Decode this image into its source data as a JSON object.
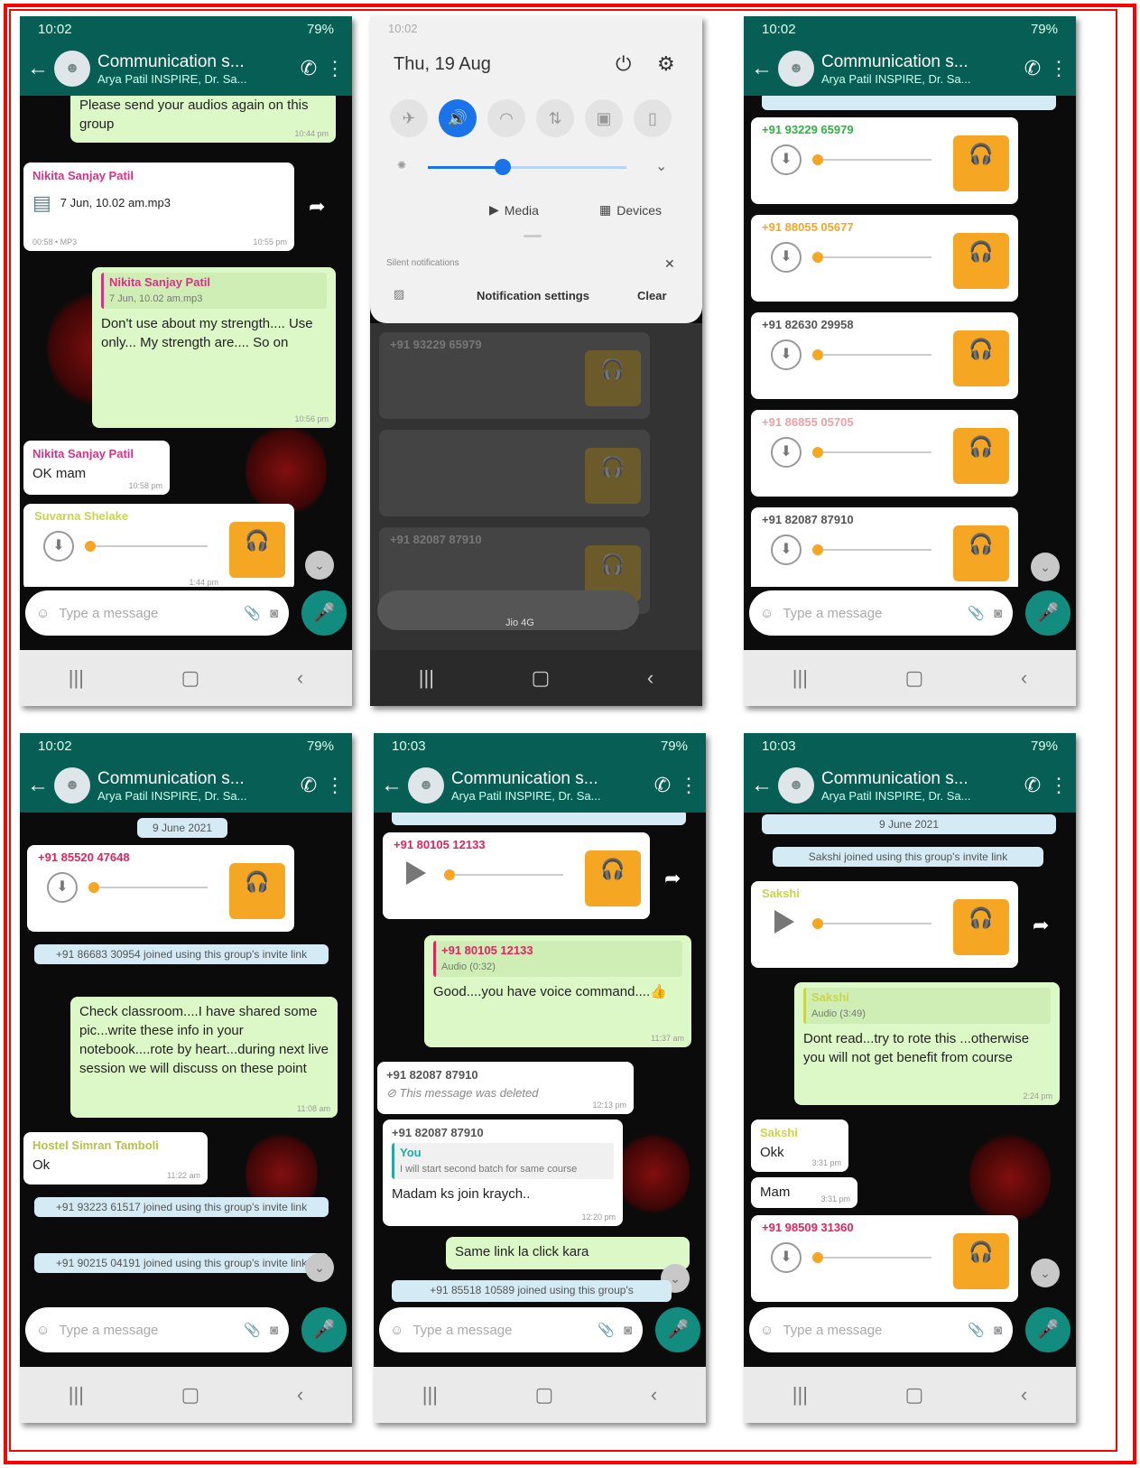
{
  "common": {
    "group_name": "Communication s...",
    "group_sub": "Arya Patil INSPIRE, Dr. Sa...",
    "input_placeholder": "Type a message",
    "signal": "79%",
    "june_date": "9 June 2021",
    "invite_suffix": "joined using this group's invite link"
  },
  "p1": {
    "time": "10:02",
    "m1_text": "Please send your audios again on this group",
    "m1_meta": "10:44 pm",
    "m2_sender": "Nikita Sanjay Patil",
    "m2_file": "7 Jun, 10.02 am.mp3",
    "m2_size": "00:58 • MP3",
    "m2_meta": "10:55 pm",
    "m3_quote_sender": "Nikita Sanjay Patil",
    "m3_quote": "7 Jun, 10.02 am.mp3",
    "m3_text": "Don't use about my strength.... Use only... My strength are.... So on",
    "m3_meta": "10:56 pm",
    "m4_sender": "Nikita Sanjay Patil",
    "m4_text": "OK mam",
    "m4_meta": "10:58 pm",
    "m5_sender": "Suvarna Shelake",
    "m5_meta": "1:44 pm"
  },
  "p2": {
    "time": "10:02",
    "date": "Thu, 19 Aug",
    "media": "Media",
    "devices": "Devices",
    "silent": "Silent notifications",
    "notif_settings": "Notification settings",
    "clear": "Clear",
    "n1": "+91 93229 65979",
    "n3": "+91 82087 87910",
    "carrier": "Jio 4G"
  },
  "p3": {
    "time": "10:02",
    "a1": "+91 93229 65979",
    "a2": "+91 88055 05677",
    "a3": "+91 82630 29958",
    "a4": "+91 86855 05705",
    "a5": "+91 82087 87910"
  },
  "p4": {
    "time": "10:02",
    "a1": "+91 85520 47648",
    "sys1": "+91 86683 30954 joined using this group's invite link",
    "m1_text": "Check classroom....I have shared some pic...write these info in your notebook....rote by heart...during next live session we will discuss on these point",
    "m1_meta": "11:08 am",
    "m2_sender": "Hostel Simran Tamboli",
    "m2_text": "Ok",
    "m2_meta": "11:22 am",
    "sys2": "+91 93223 61517 joined using this group's invite link",
    "sys3": "+91 90215 04191 joined using this group's invite link"
  },
  "p5": {
    "time": "10:03",
    "a1": "+91 80105 12133",
    "m1_quote_sender": "+91 80105 12133",
    "m1_quote": "Audio (0:32)",
    "m1_text": "Good....you have voice command....👍",
    "m1_meta": "11:37 am",
    "m2_sender": "+91 82087 87910",
    "m2_text": "This message was deleted",
    "m2_meta": "12:13 pm",
    "m3_sender": "+91 82087 87910",
    "m3_quote_sender": "You",
    "m3_quote": "I will start second batch for same course",
    "m3_text": "Madam ks join kraych..",
    "m3_meta": "12:20 pm",
    "m4_text": "Same link la click kara",
    "sys1": "+91 85518 10589 joined using this group's"
  },
  "p6": {
    "time": "10:03",
    "sys1": "Sakshi joined using this group's invite link",
    "a1": "Sakshi",
    "m1_quote_sender": "Sakshi",
    "m1_quote": "Audio (3:49)",
    "m1_text": "Dont read...try to rote this ...otherwise you will not get benefit from course",
    "m1_meta": "2:24 pm",
    "m2_sender": "Sakshi",
    "m2_text": "Okk",
    "m2_meta": "3:31 pm",
    "m3_text": "Mam",
    "m3_meta": "3:31 pm",
    "a2": "+91 98509 31360"
  }
}
